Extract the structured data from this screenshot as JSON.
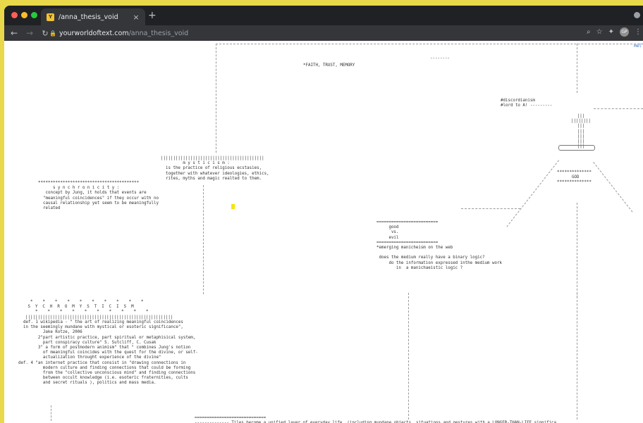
{
  "browser": {
    "tab_title": "/anna_thesis_void",
    "favicon_glyph": "Y",
    "new_tab": "+",
    "tab_close": "×",
    "url_host": "yourworldoftext.com",
    "url_path": "/anna_thesis_void",
    "avatar_initials": "GP",
    "help_link": "Hel"
  },
  "texts": {
    "faith": "*FAITH, TRUST, MEMORY",
    "faith_dashes": "--------",
    "discordianism": "#discordianism\n#lord to A! ---------",
    "pipes_column": "|||\n||||||||\n|||\n|||\n|||\n|||\n|||",
    "god_box": "**************\n      GOD\n**************",
    "mysticism": "||||||||||||||||||||||||||||||||||||||||||\n         m y s t i c i s m :\n  is the practice of religious ecstasies,\n  together with whatever ideologies, ethics,\n  rites, myths and magic realted to them.",
    "synchronicity": "*****************************************\n      s y n c h r o n i c i t y :\n   concept by Jung, it holds that events are\n  \"meaningful coincidences\" if they occur with no\n  causal relationship yet seem to be meaningfully\n  related",
    "good_evil": "=========================\n     good\n      vs.\n     evil\n=========================\n*emerging manicheism on the web\n\n does the medium really have a binary logic?\n     do the information expressed inthe medium work\n        in  a manichaeistic logic ?",
    "synchromysticism_header": "  *    *    *    *    *    *    *    *    *    *\n S  Y  C  H  R  O  M  Y  S  T  I  C  I  S  M\n    *    *    *    *    *    *    *    *    *    *\n||||||||||||||||||||||||||||||||||||||||||||||||||||||||||||",
    "synchromysticism_defs": "  def. 1 wikipedia - \" the art of realizing meaningful coincidences\n  in the seemingly mundane with mystical or esoteric significance\",\n          Jake Kotze, 2006\n        2\"part artistic practice, part spiritual or metaphisical system,\n          part conspiracy culture\" S. Sutcliff, C. Cusak\n        3\" a form of postmodern animism\" that \" combines Jung's notion\n          of meaningful coincides with the quest for the divine, or self-\n          actualization throught experience of the divine\"\ndef. 4 \"an internet practice that consist in \"drawing connections in\n          modern culture and finding connections that could be forming\n          from the \"collective unconscious mind\" and finding connections\n          between occult knowledge (i.e. esoteric fraternities, cults\n          and secret rituals ), politics and mass media.",
    "small_pipes": "|\n|\n|",
    "bottom_line": "=============================\n-------------- Tiles become a unified layer of everyday life  (including mundane objects, situations and gestures with a LONGER-THAN-LIFE significa"
  }
}
